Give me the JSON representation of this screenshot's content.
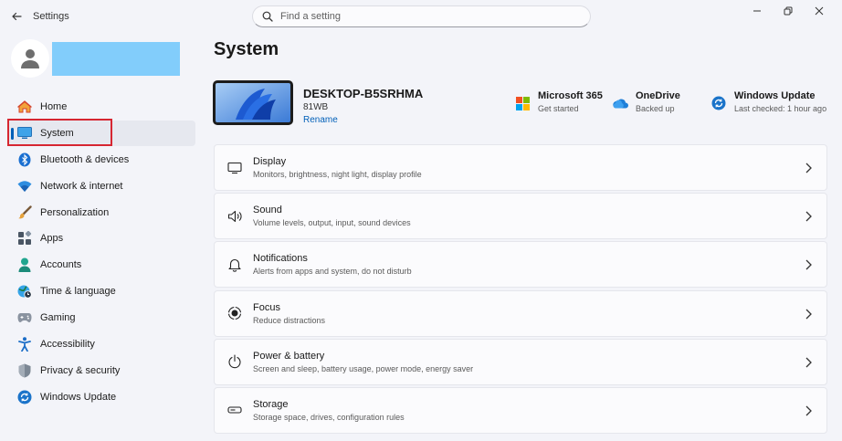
{
  "titlebar": {
    "app_title": "Settings"
  },
  "search": {
    "placeholder": "Find a setting"
  },
  "sidebar": {
    "items": [
      {
        "label": "Home"
      },
      {
        "label": "System"
      },
      {
        "label": "Bluetooth & devices"
      },
      {
        "label": "Network & internet"
      },
      {
        "label": "Personalization"
      },
      {
        "label": "Apps"
      },
      {
        "label": "Accounts"
      },
      {
        "label": "Time & language"
      },
      {
        "label": "Gaming"
      },
      {
        "label": "Accessibility"
      },
      {
        "label": "Privacy & security"
      },
      {
        "label": "Windows Update"
      }
    ],
    "active_index": 1
  },
  "main": {
    "title": "System",
    "device": {
      "name": "DESKTOP-B5SRHMA",
      "model": "81WB",
      "rename_label": "Rename"
    },
    "quick_links": [
      {
        "title": "Microsoft 365",
        "subtitle": "Get started",
        "icon": "microsoft-logo-icon"
      },
      {
        "title": "OneDrive",
        "subtitle": "Backed up",
        "icon": "cloud-icon"
      },
      {
        "title": "Windows Update",
        "subtitle": "Last checked: 1 hour ago",
        "icon": "sync-icon"
      }
    ],
    "cards": [
      {
        "title": "Display",
        "subtitle": "Monitors, brightness, night light, display profile",
        "icon": "monitor-icon"
      },
      {
        "title": "Sound",
        "subtitle": "Volume levels, output, input, sound devices",
        "icon": "speaker-icon"
      },
      {
        "title": "Notifications",
        "subtitle": "Alerts from apps and system, do not disturb",
        "icon": "bell-icon"
      },
      {
        "title": "Focus",
        "subtitle": "Reduce distractions",
        "icon": "focus-icon"
      },
      {
        "title": "Power & battery",
        "subtitle": "Screen and sleep, battery usage, power mode, energy saver",
        "icon": "power-icon"
      },
      {
        "title": "Storage",
        "subtitle": "Storage space, drives, configuration rules",
        "icon": "storage-icon"
      }
    ]
  },
  "colors": {
    "accent": "#005fb8",
    "highlight": "#d62631",
    "profile_block": "#82cdfb"
  }
}
